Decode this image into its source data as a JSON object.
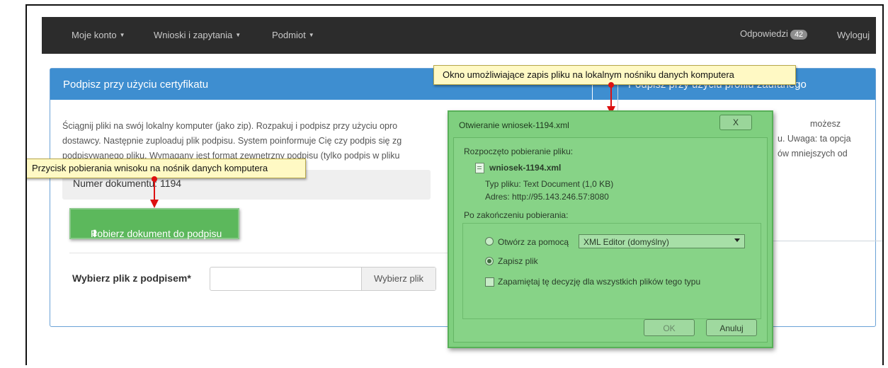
{
  "nav": {
    "account": "Moje konto",
    "requests": "Wnioski i zapytania",
    "entity": "Podmiot",
    "answers": "Odpowiedzi",
    "answers_count": "42",
    "logout": "Wyloguj"
  },
  "panel": {
    "title": "Podpisz przy użyciu certyfikatu",
    "right_title": "Podpisz przy użyciu profilu zaufanego",
    "desc_lines": [
      "Ściągnij pliki na swój lokalny komputer (jako zip). Rozpakuj i podpisz przy użyciu opro",
      "dostawcy. Następnie zuploaduj plik podpisu. System poinformuje Cię czy podpis się zg",
      "podpisywanego pliku. Wymagany jest format zewnętrzny podpisu (tylko podpis w pliku"
    ],
    "right_desc_lines": [
      "możesz",
      "u. Uwaga: ta opcja",
      "ów mniejszych od"
    ],
    "document_label": "Numer dokumentu: 1194",
    "download_button": "Pobierz dokument do podpisu",
    "file_label": "Wybierz plik z podpisem*",
    "file_button": "Wybierz plik"
  },
  "callouts": {
    "dialog_note": "Okno umożliwiające zapis pliku na lokalnym nośniku danych komputera",
    "button_note": "Przycisk pobierania wnisoku na nośnik danych komputera"
  },
  "dialog": {
    "title": "Otwieranie wniosek-1194.xml",
    "close": "X",
    "started": "Rozpoczęto pobieranie pliku:",
    "file_name": "wniosek-1194.xml",
    "type": "Typ pliku: Text Document (1,0 KB)",
    "address": "Adres: http://95.143.246.57:8080",
    "after": "Po zakończeniu pobierania:",
    "open_with": "Otwórz za pomocą",
    "open_with_value": "XML Editor (domyślny)",
    "save": "Zapisz plik",
    "remember": "Zapamiętaj tę decyzję dla wszystkich plików tego typu",
    "ok": "OK",
    "cancel": "Anuluj"
  },
  "colors": {
    "nav_bg": "#2c2c2c",
    "panel_header": "#3e8ed0",
    "success": "#5cb85c",
    "dialog": "#7fcf7f",
    "callout": "#fff9c4"
  }
}
